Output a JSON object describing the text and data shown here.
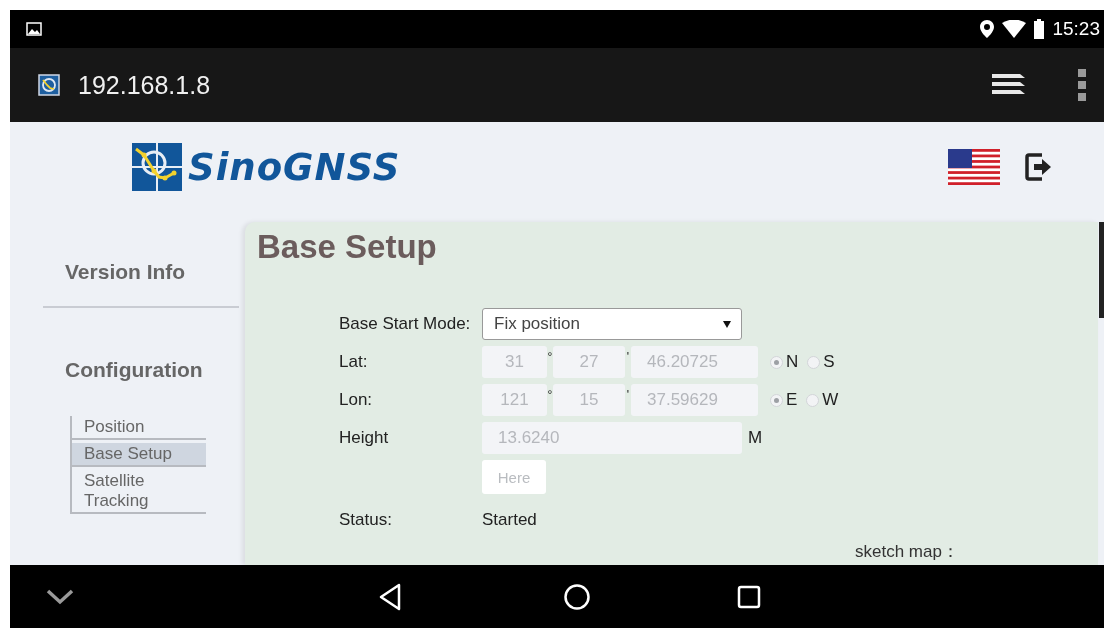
{
  "status_bar": {
    "time": "15:23"
  },
  "address_bar": {
    "url": "192.168.1.8"
  },
  "header": {
    "logo_text": "SinoGNSS"
  },
  "sidebar": {
    "sections": [
      {
        "label": "Version Info"
      },
      {
        "label": "Configuration",
        "children": [
          {
            "label": "Position",
            "selected": false
          },
          {
            "label": "Base Setup",
            "selected": true
          },
          {
            "label": "Satellite Tracking",
            "selected": false
          }
        ]
      }
    ]
  },
  "form": {
    "title": "Base Setup",
    "base_start_mode": {
      "label": "Base Start Mode:",
      "value": "Fix position"
    },
    "coordinates": [
      {
        "label": "Lat:",
        "degrees": "31",
        "degree_mark": "°",
        "minutes": "27",
        "minute_mark": "'",
        "seconds": "46.20725",
        "options": [
          {
            "label": "N",
            "selected": true
          },
          {
            "label": "S",
            "selected": false
          }
        ]
      },
      {
        "label": "Lon:",
        "degrees": "121",
        "degree_mark": "°",
        "minutes": "15",
        "minute_mark": "'",
        "seconds": "37.59629",
        "options": [
          {
            "label": "E",
            "selected": true
          },
          {
            "label": "W",
            "selected": false
          }
        ]
      }
    ],
    "height": {
      "label": "Height",
      "value": "13.6240",
      "unit": "M"
    },
    "here_button": {
      "label": "Here",
      "disabled": true
    },
    "status": {
      "label": "Status:",
      "value": "Started"
    },
    "sketch_map_label": "sketch map："
  }
}
